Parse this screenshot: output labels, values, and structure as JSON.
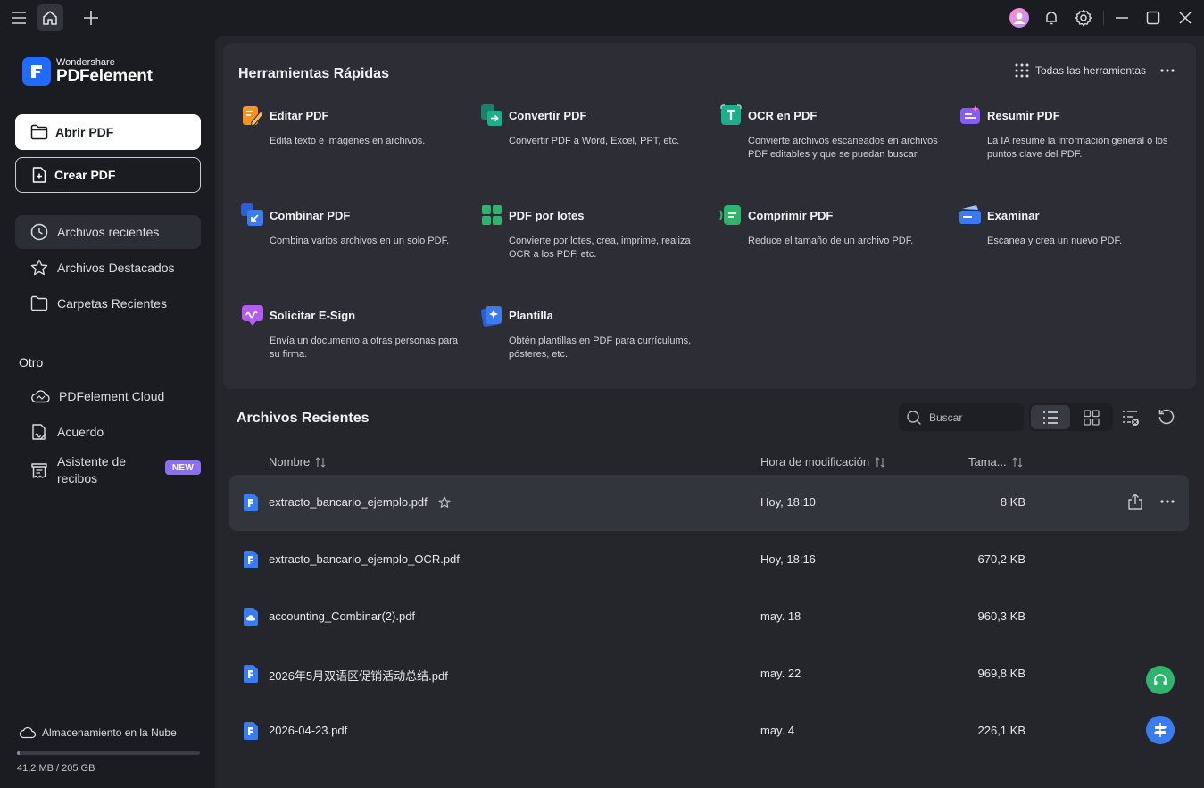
{
  "app": {
    "brand_top": "Wondershare",
    "brand_name": "PDFelement"
  },
  "sidebar": {
    "open_pdf": "Abrir PDF",
    "create_pdf": "Crear PDF",
    "nav": [
      {
        "label": "Archivos recientes",
        "icon": "clock-icon"
      },
      {
        "label": "Archivos Destacados",
        "icon": "star-icon"
      },
      {
        "label": "Carpetas Recientes",
        "icon": "folder-icon"
      }
    ],
    "other_label": "Otro",
    "other": [
      {
        "label": "PDFelement Cloud",
        "icon": "cloud-icon"
      },
      {
        "label": "Acuerdo",
        "icon": "sign-document-icon"
      },
      {
        "label": "Asistente de recibos",
        "icon": "receipt-icon",
        "badge": "NEW"
      }
    ],
    "storage": {
      "label": "Almacenamiento en la Nube",
      "value": "41,2 MB / 205 GB",
      "used_fraction": 0.0002
    }
  },
  "quick_tools": {
    "title": "Herramientas Rápidas",
    "all_tools": "Todas las herramientas",
    "tools": [
      {
        "name": "Editar PDF",
        "desc": "Edita texto e imágenes en archivos.",
        "icon": "edit-pdf-icon",
        "color": "#f7931e"
      },
      {
        "name": "Convertir PDF",
        "desc": "Convertir PDF a Word, Excel, PPT, etc.",
        "icon": "convert-pdf-icon",
        "color": "#1fae8c"
      },
      {
        "name": "OCR en PDF",
        "desc": "Convierte archivos escaneados en archivos PDF editables y que se puedan buscar.",
        "icon": "ocr-icon",
        "color": "#1fae8c"
      },
      {
        "name": "Resumir PDF",
        "desc": "La IA resume la información general o los puntos clave del PDF.",
        "icon": "ai-summary-icon",
        "color": "#8a5cf6"
      },
      {
        "name": "Combinar PDF",
        "desc": "Combina varios archivos en un solo PDF.",
        "icon": "combine-pdf-icon",
        "color": "#3a7bf2"
      },
      {
        "name": "PDF por lotes",
        "desc": "Convierte por lotes, crea, imprime, realiza OCR a los PDF, etc.",
        "icon": "batch-pdf-icon",
        "color": "#2fb36d"
      },
      {
        "name": "Comprimir PDF",
        "desc": "Reduce el tamaño de un archivo PDF.",
        "icon": "compress-pdf-icon",
        "color": "#2fb36d"
      },
      {
        "name": "Examinar",
        "desc": "Escanea y crea un nuevo PDF.",
        "icon": "scan-icon",
        "color": "#3a7bf2"
      },
      {
        "name": "Solicitar E-Sign",
        "desc": "Envía un documento a otras personas para su firma.",
        "icon": "esign-icon",
        "color": "#b35cf0"
      },
      {
        "name": "Plantilla",
        "desc": "Obtén plantillas en PDF para currículums, pósteres, etc.",
        "icon": "template-icon",
        "color": "#3a7bf2"
      }
    ]
  },
  "recent": {
    "title": "Archivos Recientes",
    "search_placeholder": "Buscar",
    "columns": {
      "name": "Nombre",
      "time": "Hora de modificación",
      "size": "Tama..."
    },
    "files": [
      {
        "name": "extracto_bancario_ejemplo.pdf",
        "time": "Hoy, 18:10",
        "size": "8 KB",
        "icon": "pdf-file-icon"
      },
      {
        "name": "extracto_bancario_ejemplo_OCR.pdf",
        "time": "Hoy, 18:16",
        "size": "670,2 KB",
        "icon": "pdf-file-icon"
      },
      {
        "name": "accounting_Combinar(2).pdf",
        "time": "may. 18",
        "size": "960,3 KB",
        "icon": "cloud-pdf-file-icon"
      },
      {
        "name": "2026年5月双语区促销活动总结.pdf",
        "time": "may. 22",
        "size": "969,8 KB",
        "icon": "pdf-file-icon"
      },
      {
        "name": "2026-04-23.pdf",
        "time": "may. 4",
        "size": "226,1 KB",
        "icon": "pdf-file-icon"
      }
    ]
  }
}
